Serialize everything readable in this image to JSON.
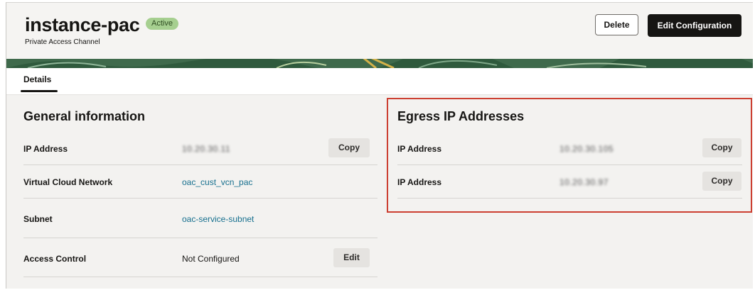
{
  "header": {
    "title": "instance-pac",
    "status": "Active",
    "subtitle": "Private Access Channel",
    "delete_label": "Delete",
    "edit_config_label": "Edit Configuration"
  },
  "tabs": [
    {
      "label": "Details",
      "selected": true
    }
  ],
  "general": {
    "title": "General information",
    "rows": [
      {
        "label": "IP Address",
        "value": "10.20.30.11",
        "masked": true,
        "action": "Copy"
      },
      {
        "label": "Virtual Cloud Network",
        "value": "oac_cust_vcn_pac",
        "link": true
      },
      {
        "label": "Subnet",
        "value": "oac-service-subnet",
        "link": true
      },
      {
        "label": "Access Control",
        "value": "Not Configured",
        "action": "Edit"
      }
    ]
  },
  "egress": {
    "title": "Egress IP Addresses",
    "rows": [
      {
        "label": "IP Address",
        "value": "10.20.30.105",
        "masked": true,
        "action": "Copy"
      },
      {
        "label": "IP Address",
        "value": "10.20.30.97",
        "masked": true,
        "action": "Copy"
      }
    ]
  },
  "colors": {
    "accent_link": "#166f8e",
    "status_badge": "#a6cf90",
    "highlight_border": "#cc3f31",
    "primary_button": "#161513"
  }
}
